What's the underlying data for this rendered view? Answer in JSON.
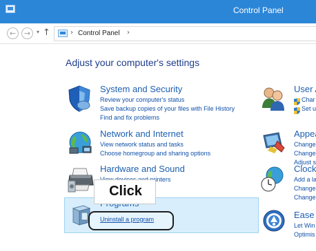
{
  "window": {
    "title": "Control Panel"
  },
  "addressbar": {
    "back_glyph": "←",
    "forward_glyph": "→",
    "dropdown_glyph": "▾",
    "up_glyph": "↑",
    "separator": "›",
    "crumb": "Control Panel"
  },
  "page": {
    "title": "Adjust your computer's settings"
  },
  "categories": {
    "system_security": {
      "title": "System and Security",
      "links": [
        "Review your computer's status",
        "Save backup copies of your files with File History",
        "Find and fix problems"
      ],
      "icon": "shield-icon"
    },
    "network": {
      "title": "Network and Internet",
      "links": [
        "View network status and tasks",
        "Choose homegroup and sharing options"
      ],
      "icon": "globe-network-icon"
    },
    "hardware": {
      "title": "Hardware and Sound",
      "links": [
        "View devices and printers"
      ],
      "icon": "printer-icon"
    },
    "programs": {
      "title": "Programs",
      "links": [
        "Uninstall a program"
      ],
      "icon": "programs-box-icon"
    },
    "user_accounts": {
      "title": "User A",
      "links": [
        "Char",
        "Set u"
      ],
      "icon": "users-icon"
    },
    "appearance": {
      "title": "Appea",
      "links": [
        "Change",
        "Change",
        "Adjust s"
      ],
      "icon": "appearance-icon"
    },
    "clock": {
      "title": "Clock,",
      "links": [
        "Add a la",
        "Change",
        "Change"
      ],
      "icon": "clock-globe-icon"
    },
    "ease": {
      "title": "Ease c",
      "links": [
        "Let Win",
        "Optimis"
      ],
      "icon": "ease-of-access-icon"
    }
  },
  "annotation": {
    "callout_text": "Click"
  },
  "colors": {
    "titlebar": "#2c86d8",
    "link": "#0f50a8",
    "category_title": "#1c5fb1",
    "highlight": "#d8eefc"
  }
}
